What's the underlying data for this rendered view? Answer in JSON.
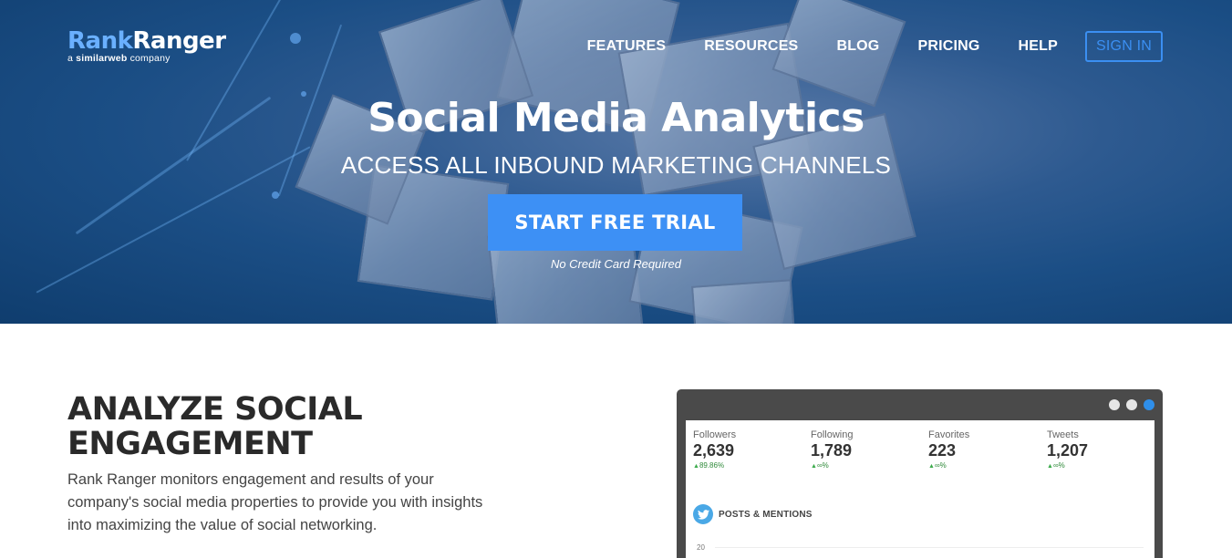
{
  "brand": {
    "name_part1": "Rank",
    "name_part2": "Ranger",
    "tagline_prefix": "a ",
    "tagline_brand": "similarweb",
    "tagline_suffix": " company",
    "accent": "#6ab0ff"
  },
  "nav": {
    "items": [
      {
        "label": "FEATURES"
      },
      {
        "label": "RESOURCES"
      },
      {
        "label": "BLOG"
      },
      {
        "label": "PRICING"
      },
      {
        "label": "HELP"
      }
    ],
    "signin_label": "SIGN IN"
  },
  "hero": {
    "title": "Social Media Analytics",
    "subtitle": "ACCESS ALL INBOUND MARKETING CHANNELS",
    "cta_label": "START FREE TRIAL",
    "cta_note": "No Credit Card Required",
    "cta_color": "#3d90f5"
  },
  "section": {
    "title_line1": "ANALYZE SOCIAL",
    "title_line2": "ENGAGEMENT",
    "body": "Rank Ranger monitors engagement and results of your company's social media properties to provide you with insights into maximizing the value of social networking."
  },
  "dashboard": {
    "window_dots": [
      "#e6e6e6",
      "#e6e6e6",
      "#2f8fea"
    ],
    "stats": [
      {
        "label": "Followers",
        "value": "2,639",
        "change": "89.86%"
      },
      {
        "label": "Following",
        "value": "1,789",
        "change": "∞%"
      },
      {
        "label": "Favorites",
        "value": "223",
        "change": "∞%"
      },
      {
        "label": "Tweets",
        "value": "1,207",
        "change": "∞%"
      }
    ],
    "posts_label": "POSTS & MENTIONS",
    "axis_tick": "20",
    "icon": "twitter-bird-icon"
  }
}
